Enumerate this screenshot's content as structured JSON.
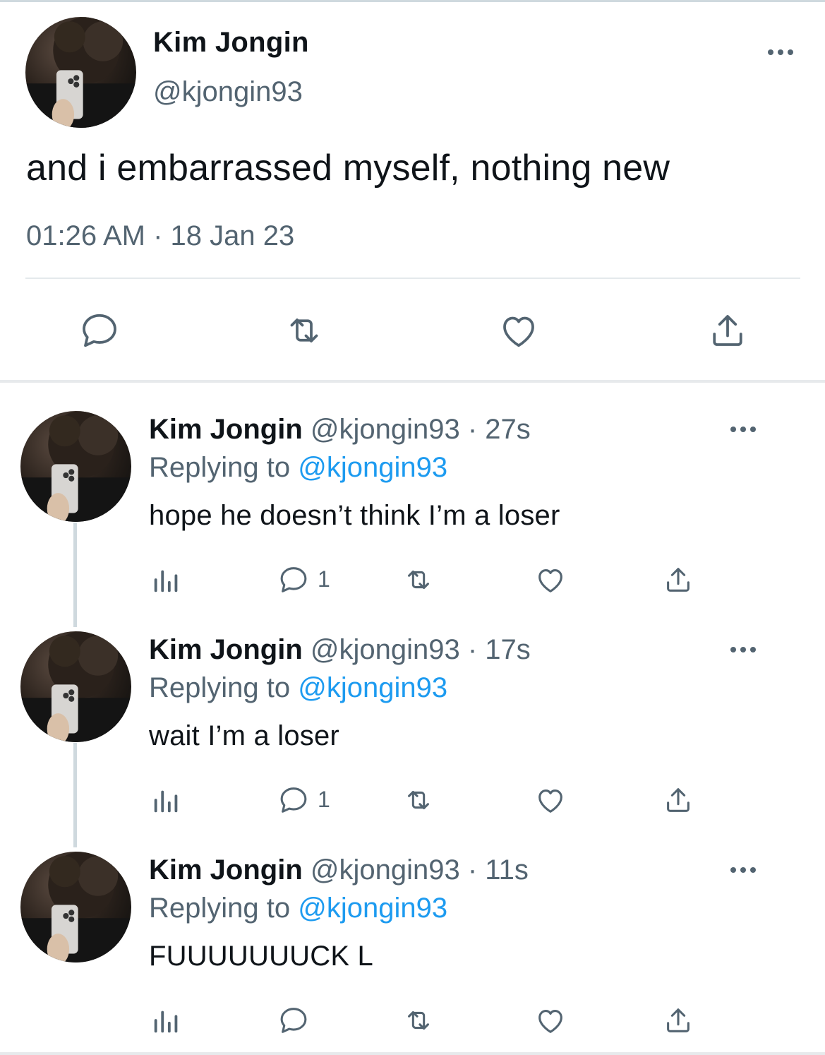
{
  "main_tweet": {
    "name": "Kim Jongin",
    "handle": "@kjongin93",
    "text": "and i embarrassed myself, nothing new",
    "timestamp": "01:26 AM · 18 Jan 23",
    "icons": [
      "reply-icon",
      "retweet-icon",
      "like-icon",
      "share-icon"
    ]
  },
  "replies": [
    {
      "name": "Kim Jongin",
      "meta": "@kjongin93 · 27s",
      "replying_prefix": "Replying to ",
      "replying_handle": "@kjongin93",
      "text": "hope he doesn’t think I’m a loser",
      "reply_count": "1"
    },
    {
      "name": "Kim Jongin",
      "meta": "@kjongin93 · 17s",
      "replying_prefix": "Replying to ",
      "replying_handle": "@kjongin93",
      "text": "wait I’m a loser",
      "reply_count": "1"
    },
    {
      "name": "Kim Jongin",
      "meta": "@kjongin93 · 11s",
      "replying_prefix": "Replying to ",
      "replying_handle": "@kjongin93",
      "text": "FUUUUUUUCK L",
      "reply_count": ""
    }
  ],
  "colors": {
    "text": "#0f1419",
    "secondary": "#536471",
    "link": "#1d9bf0",
    "divider": "#e7eaec"
  }
}
